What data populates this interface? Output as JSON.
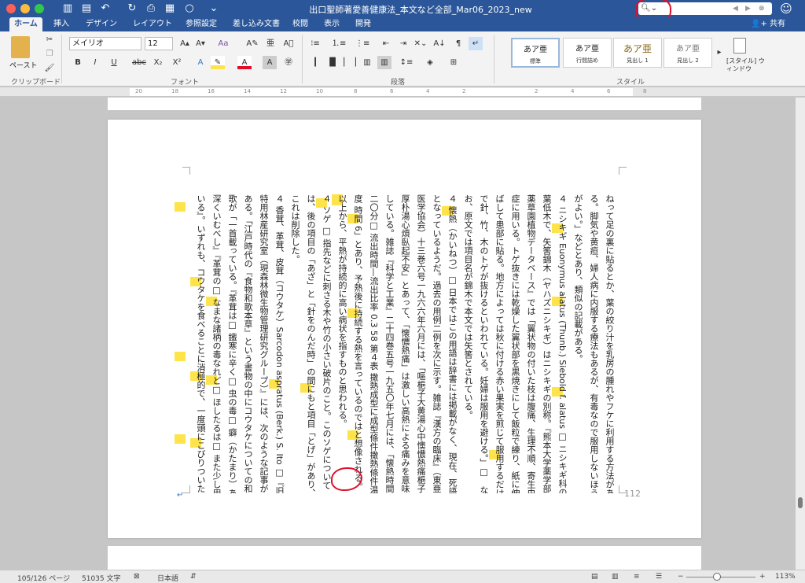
{
  "window": {
    "title": "出口聖師著愛善健康法_本文など全部_Mar06_2023_new"
  },
  "quick_access": {
    "icons": [
      "sidebar-icon",
      "save-icon",
      "undo-icon",
      "redo-icon",
      "print-icon",
      "format-icon",
      "shape-icon",
      "more-icon"
    ]
  },
  "search": {
    "placeholder": "",
    "icon": "magnifier-icon"
  },
  "tabs": [
    "ホーム",
    "挿入",
    "デザイン",
    "レイアウト",
    "参照設定",
    "差し込み文書",
    "校閲",
    "表示",
    "開発"
  ],
  "active_tab": "ホーム",
  "share_label": "共有",
  "ribbon": {
    "paste_label": "ペースト",
    "clipboard_label": "クリップボード",
    "font_label": "フォント",
    "paragraph_label": "段落",
    "style_label": "スタイル",
    "font_name": "メイリオ",
    "font_size": "12",
    "font_buttons": [
      "B",
      "I",
      "U",
      "abc",
      "X₂",
      "X²"
    ],
    "styles": [
      {
        "sample": "あア亜",
        "name": "標準"
      },
      {
        "sample": "あア亜",
        "name": "行間詰め"
      },
      {
        "sample": "あア亜",
        "name": "見出し 1"
      },
      {
        "sample": "あア亜",
        "name": "見出し 2"
      }
    ],
    "style_window_label": "[スタイル] ウィンドウ"
  },
  "ruler_numbers": [
    "20",
    "18",
    "16",
    "14",
    "12",
    "10",
    "8",
    "6",
    "4",
    "2",
    "2",
    "4",
    "6",
    "8"
  ],
  "document": {
    "lines": [
      "ねって足の裏に貼るとか、葉の絞り汁を乳房の腫れやフケに利用する方法があ",
      "る。脚気や黄疸、婦人病に内服する療法もあるが、有毒なので服用しないほう",
      "がよい。」などとあり、類似の記載がある。",
      "４ ニシキギ Euonymus alatus (Thunb.) Siebold f. alatus □ ニシキギ科の落",
      "葉低木で、矢筈錦木（ヤハズニシキギ）はニシキギの別称。『熊本大学薬学部",
      "薬草園植物データベース』では「翼状物の付いた枝は腹痛、生理不順、寄生虫",
      "症に用いる。トゲ抜きには乾燥した翼状部を黒焼きにして飯粒で練り、紙に伸",
      "ばして患部に貼る。地方によっては秋に付ける赤い果実を煎じて服用するだけ",
      "で針、竹、木のトゲが抜けるといわれている。妊婦は服用を避ける。」□　な",
      "お、原文では項目名が錦木で本文では矢筈とされている。",
      "４ 懐熱（かいねつ）□ 日本ではこの用語は辞書には掲載がなく、現在、死語",
      "となっているようだ。過去の用例二例を次に示す。雑誌『漢方の臨床』（東亜",
      "医学協会）十三巻六号一九六六年六月には、「嘔梔子大黄湯心中懊憹熱痛梔子",
      "厚朴湯心煩臥起不安」とあって、「懐憹熱痛」は激しい高熱による痛みを意味",
      "している。雑誌『科学と工業』二十四巻五号一九五〇年七月には、「懐熱時間",
      "二〇分□ 流出時間—流出比率 0.3 58 第４表 撒熱成型に成型條件撒熱條件温",
      "度 時間 6」とあり、予熱後に持続する熱を言っているのではと想像される。",
      "以上から、平熱が持続的に高い病状を指すものと思われる。",
      "４ ソゲ □ 指先などに刺さる木や竹の小さい破片のこと。このソゲについて",
      "は、後の項目の「あざ」と「針をのんだ時」の間にもと項目「とげ」があり、",
      "これは削除した。",
      "４ 香茸、革茸、皮茸（コウタケ）Sarcodon aspratus (Berk.) S. Ito □『旧",
      "特用林産研究室（現森林微生物管理研究グループ）』には、次のような記事が",
      "ある。「江戸時代の『食物和歌本草』という書物の中にコウタケについての和",
      "歌が「一首載っている。『革茸は□ 鐵寒に辛く□ 虫の毒□ 癖（かたまり）あらば□",
      "深くいむべし』『革茸の□ なまな諸柄の毒なれど□ ほしたるは□ また少し用",
      "いる』。いずれも、コウタケを食べることに消極的で、一度頭にこびりついた"
    ],
    "page_number": "112"
  },
  "status": {
    "page": "105/126 ページ",
    "words": "51035 文字",
    "language": "日本語",
    "zoom": "113%",
    "zoom_fraction": 0.44
  },
  "colors": {
    "titlebar": "#2b579a",
    "highlight": "#ffe34a",
    "annotation": "#e0102a"
  }
}
